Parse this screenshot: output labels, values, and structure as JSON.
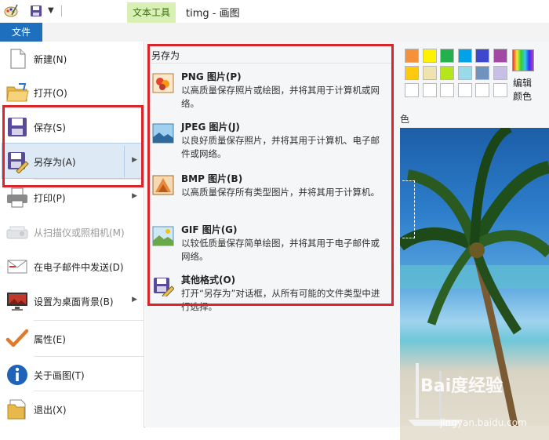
{
  "window": {
    "context_tab": "文本工具",
    "title": "timg - 画图"
  },
  "ribbon": {
    "file_tab": "文件",
    "edit_colors_label": "编辑\n颜色",
    "group_label_fragment": "色",
    "palette": [
      "#f7903b",
      "#fff200",
      "#22b14c",
      "#00a2e8",
      "#3f48cc",
      "#a349a4",
      "#ffc90e",
      "#efe4b0",
      "#b5e61d",
      "#99d9ea",
      "#7092be",
      "#c8bfe7",
      "#ffffff",
      "#ffffff",
      "#ffffff",
      "#ffffff",
      "#ffffff",
      "#ffffff"
    ]
  },
  "file_menu": {
    "items": [
      {
        "label": "新建(N)",
        "icon": "new-file-icon",
        "has_arrow": false,
        "enabled": true
      },
      {
        "label": "打开(O)",
        "icon": "open-folder-icon",
        "has_arrow": false,
        "enabled": true
      },
      {
        "label": "保存(S)",
        "icon": "save-disk-icon",
        "has_arrow": false,
        "enabled": true
      },
      {
        "label": "另存为(A)",
        "icon": "save-as-icon",
        "has_arrow": true,
        "enabled": true
      },
      {
        "label": "打印(P)",
        "icon": "printer-icon",
        "has_arrow": true,
        "enabled": true
      },
      {
        "label": "从扫描仪或照相机(M)",
        "icon": "scanner-icon",
        "has_arrow": false,
        "enabled": false
      },
      {
        "label": "在电子邮件中发送(D)",
        "icon": "email-icon",
        "has_arrow": false,
        "enabled": true
      },
      {
        "label": "设置为桌面背景(B)",
        "icon": "desktop-background-icon",
        "has_arrow": true,
        "enabled": true
      },
      {
        "label": "属性(E)",
        "icon": "checkmark-icon",
        "has_arrow": false,
        "enabled": true
      },
      {
        "label": "关于画图(T)",
        "icon": "info-icon",
        "has_arrow": false,
        "enabled": true
      },
      {
        "label": "退出(X)",
        "icon": "exit-icon",
        "has_arrow": false,
        "enabled": true
      }
    ]
  },
  "save_as_menu": {
    "title": "另存为",
    "items": [
      {
        "title": "PNG 图片(P)",
        "desc": "以高质量保存照片或绘图，并将其用于计算机或网络。",
        "icon": "png-image-icon"
      },
      {
        "title": "JPEG 图片(J)",
        "desc": "以良好质量保存照片，并将其用于计算机、电子邮件或网络。",
        "icon": "jpeg-image-icon"
      },
      {
        "title": "BMP 图片(B)",
        "desc": "以高质量保存所有类型图片，并将其用于计算机。",
        "icon": "bmp-image-icon"
      },
      {
        "title": "GIF 图片(G)",
        "desc": "以较低质量保存简单绘图，并将其用于电子邮件或网络。",
        "icon": "gif-image-icon"
      },
      {
        "title": "其他格式(O)",
        "desc": "打开“另存为”对话框，从所有可能的文件类型中进行选择。",
        "icon": "other-formats-icon"
      }
    ]
  },
  "watermark": {
    "logo": "Bai度经验",
    "url": "jingyan.baidu.com"
  },
  "colors": {
    "file_tab": "#1f6fbf",
    "context_tab_bg": "#d9f0b5",
    "highlight": "#d9262a"
  }
}
